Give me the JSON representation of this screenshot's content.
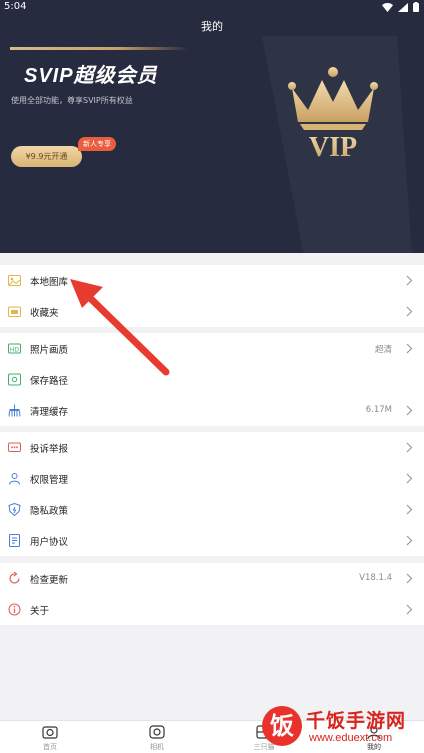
{
  "status_bar": {
    "time": "5:04"
  },
  "page": {
    "title": "我的"
  },
  "vip_banner": {
    "title": "SVIP超级会员",
    "subtitle": "使用全部功能，尊享SVIP所有权益",
    "button_label": "¥9.9元开通",
    "badge": "新人专享",
    "emblem_text": "VIP"
  },
  "sections": {
    "gallery": [
      {
        "label": "本地图库",
        "value": "",
        "icon": "image-icon"
      },
      {
        "label": "收藏夹",
        "value": "",
        "icon": "folder-icon"
      }
    ],
    "storage": [
      {
        "label": "照片画质",
        "value": "超清",
        "icon": "hd-icon"
      },
      {
        "label": "保存路径",
        "value": "",
        "icon": "save-path-icon"
      },
      {
        "label": "清理缓存",
        "value": "6.17M",
        "icon": "broom-icon"
      }
    ],
    "legal": [
      {
        "label": "投诉举报",
        "value": "",
        "icon": "report-icon"
      },
      {
        "label": "权限管理",
        "value": "",
        "icon": "permission-icon"
      },
      {
        "label": "隐私政策",
        "value": "",
        "icon": "shield-icon"
      },
      {
        "label": "用户协议",
        "value": "",
        "icon": "agreement-icon"
      }
    ],
    "about": [
      {
        "label": "检查更新",
        "value": "V18.1.4",
        "icon": "update-icon"
      },
      {
        "label": "关于",
        "value": "",
        "icon": "info-icon"
      }
    ]
  },
  "bottom_nav": [
    {
      "label": "首页",
      "icon": "home-camera-icon"
    },
    {
      "label": "相机",
      "icon": "camera-icon"
    },
    {
      "label": "三只猫",
      "icon": "cat-icon"
    },
    {
      "label": "我的",
      "icon": "profile-icon"
    }
  ],
  "watermark": {
    "mark": "饭",
    "name": "千饭手游网",
    "url": "www.eduext.com"
  },
  "colors": {
    "header_bg": "#272b3f",
    "gold": "#d8b474",
    "badge_red": "#ea5e3f",
    "icon_yellow": "#e2b64a",
    "icon_green": "#3fb06a",
    "icon_blue": "#4a7fd8",
    "icon_red": "#e25a5a",
    "arrow_red": "#e63b2e"
  }
}
